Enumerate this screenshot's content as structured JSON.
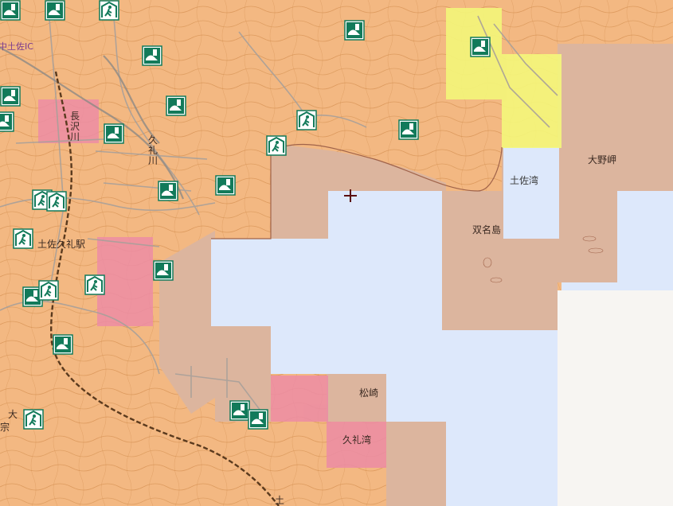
{
  "map": {
    "labels": {
      "ic": "中土佐IC",
      "river_nagasawa": "長沢川",
      "river_kure": "久礼川",
      "station": "土佐久礼駅",
      "tosa_bay": "土佐湾",
      "cape_ono": "大野岬",
      "futana": "双名島",
      "matsuzaki": "松崎",
      "kure_bay": "久礼湾",
      "edge_o": "大",
      "edge_town": "宗",
      "edge_tsuchi": "土"
    },
    "icons": {
      "shelter": "evacuation-shelter-icon",
      "tsunami_shelter": "tsunami-evacuation-building-icon",
      "center": "crosshair-icon"
    },
    "colors": {
      "land": "#f3b882",
      "contour": "#c9813f",
      "road": "#a8a09a",
      "sea": "#dde8fb",
      "hazard_brown": "#dcb59e",
      "hazard_pink": "#ec8ca5",
      "hazard_yellow": "#f4f77a",
      "shelter_green": "#127a5a",
      "railway": "#5a3a1e"
    }
  }
}
